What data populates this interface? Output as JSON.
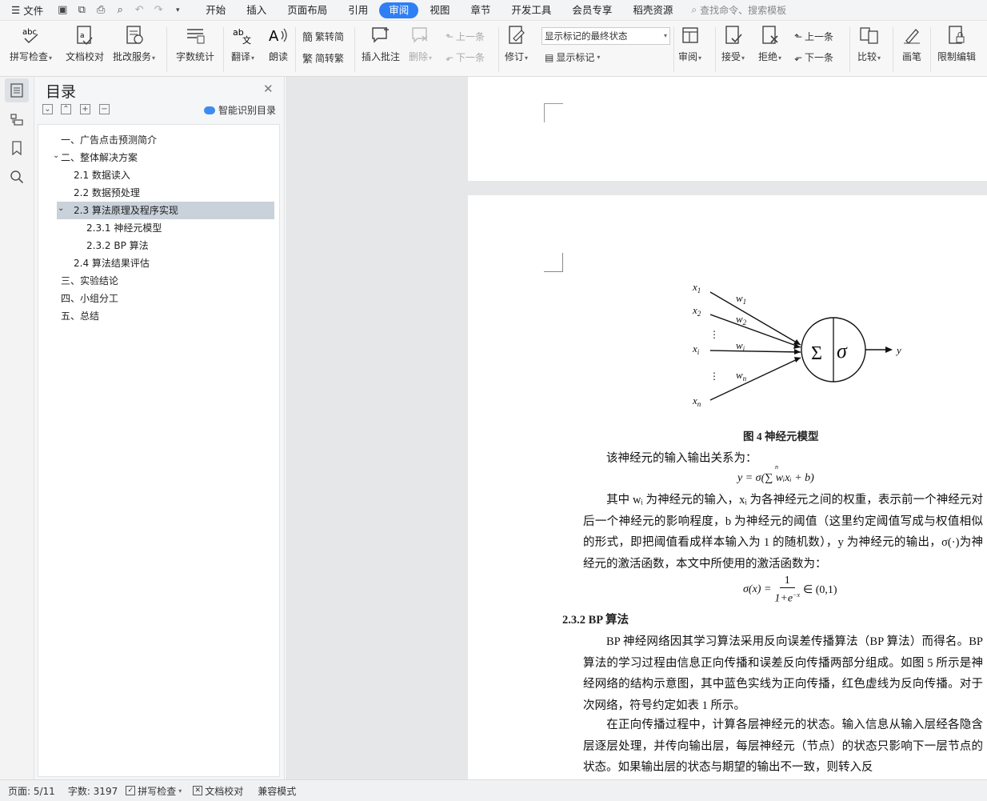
{
  "menubar": {
    "file_label": "文件",
    "tabs": [
      {
        "label": "开始",
        "active": false
      },
      {
        "label": "插入",
        "active": false
      },
      {
        "label": "页面布局",
        "active": false
      },
      {
        "label": "引用",
        "active": false
      },
      {
        "label": "审阅",
        "active": true
      },
      {
        "label": "视图",
        "active": false
      },
      {
        "label": "章节",
        "active": false
      },
      {
        "label": "开发工具",
        "active": false
      },
      {
        "label": "会员专享",
        "active": false
      },
      {
        "label": "稻壳资源",
        "active": false
      }
    ],
    "search_placeholder": "查找命令、搜索模板"
  },
  "ribbon": {
    "spell_check": "拼写检查",
    "doc_proofread": "文档校对",
    "batch_service": "批改服务",
    "word_count": "字数统计",
    "translate": "翻译",
    "read_aloud": "朗读",
    "trad_to_simp": "繁转简",
    "simp_to_trad": "简转繁",
    "insert_comment": "插入批注",
    "delete": "删除",
    "prev_comment": "上一条",
    "next_comment": "下一条",
    "track_changes": "修订",
    "markup_state": "显示标记的最终状态",
    "show_markup": "显示标记",
    "review_pane": "审阅",
    "accept": "接受",
    "reject": "拒绝",
    "prev_change": "上一条",
    "next_change": "下一条",
    "compare": "比较",
    "pen": "画笔",
    "restrict_edit": "限制编辑"
  },
  "toc": {
    "title": "目录",
    "smart_toc": "智能识别目录",
    "items": [
      {
        "label": "一、广告点击预测简介",
        "level": 1
      },
      {
        "label": "二、整体解决方案",
        "level": 1
      },
      {
        "label": "2.1  数据读入",
        "level": 2
      },
      {
        "label": "2.2  数据预处理",
        "level": 2
      },
      {
        "label": "2.3  算法原理及程序实现",
        "level": 2
      },
      {
        "label": "2.3.1  神经元模型",
        "level": 3
      },
      {
        "label": "2.3.2 BP 算法",
        "level": 3
      },
      {
        "label": "2.4  算法结果评估",
        "level": 2
      },
      {
        "label": "三、实验结论",
        "level": 1
      },
      {
        "label": "四、小组分工",
        "level": 1
      },
      {
        "label": "五、总结",
        "level": 1
      }
    ]
  },
  "document": {
    "figure": {
      "x1": "x",
      "x1_sub": "1",
      "x2": "x",
      "x2_sub": "2",
      "xi": "x",
      "xi_sub": "i",
      "xn": "x",
      "xn_sub": "n",
      "w1": "w",
      "w1_sub": "1",
      "w2": "w",
      "w2_sub": "2",
      "wi": "w",
      "wi_sub": "i",
      "wn": "w",
      "wn_sub": "n",
      "sum": "Σ",
      "sigma": "σ",
      "y": "y",
      "dots": "⋮"
    },
    "caption": "图 4  神经元模型",
    "p_intro": "该神经元的输入输出关系为：",
    "eq1": "y = σ(∑ wᵢxᵢ + b)",
    "eq1_top": "n",
    "p_explain": "其中 wᵢ 为神经元的输入，xᵢ 为各神经元之间的权重，表示前一个神经元对后一个神经元的影响程度，b 为神经元的阈值（这里约定阈值写成与权值相似的形式，即把阈值看成样本输入为 1 的随机数），y 为神经元的输出，σ(·)为神经元的激活函数，本文中所使用的激活函数为：",
    "eq2_left": "σ(x) =",
    "eq2_num": "1",
    "eq2_den": "1+e",
    "eq2_exp": "−x",
    "eq2_right": "∈ (0,1)",
    "heading": "2.3.2 BP 算法",
    "p_bp1": "BP 神经网络因其学习算法采用反向误差传播算法（BP 算法）而得名。BP 算法的学习过程由信息正向传播和误差反向传播两部分组成。如图 5 所示是神经网络的结构示意图，其中蓝色实线为正向传播，红色虚线为反向传播。对于次网络，符号约定如表 1 所示。",
    "p_bp2": "在正向传播过程中，计算各层神经元的状态。输入信息从输入层经各隐含层逐层处理，并传向输出层，每层神经元（节点）的状态只影响下一层节点的状态。如果输出层的状态与期望的输出不一致，则转入反"
  },
  "status": {
    "page": "页面: 5/11",
    "words": "字数: 3197",
    "spell_check": "拼写检查",
    "doc_proofread": "文档校对",
    "compat_mode": "兼容模式"
  }
}
